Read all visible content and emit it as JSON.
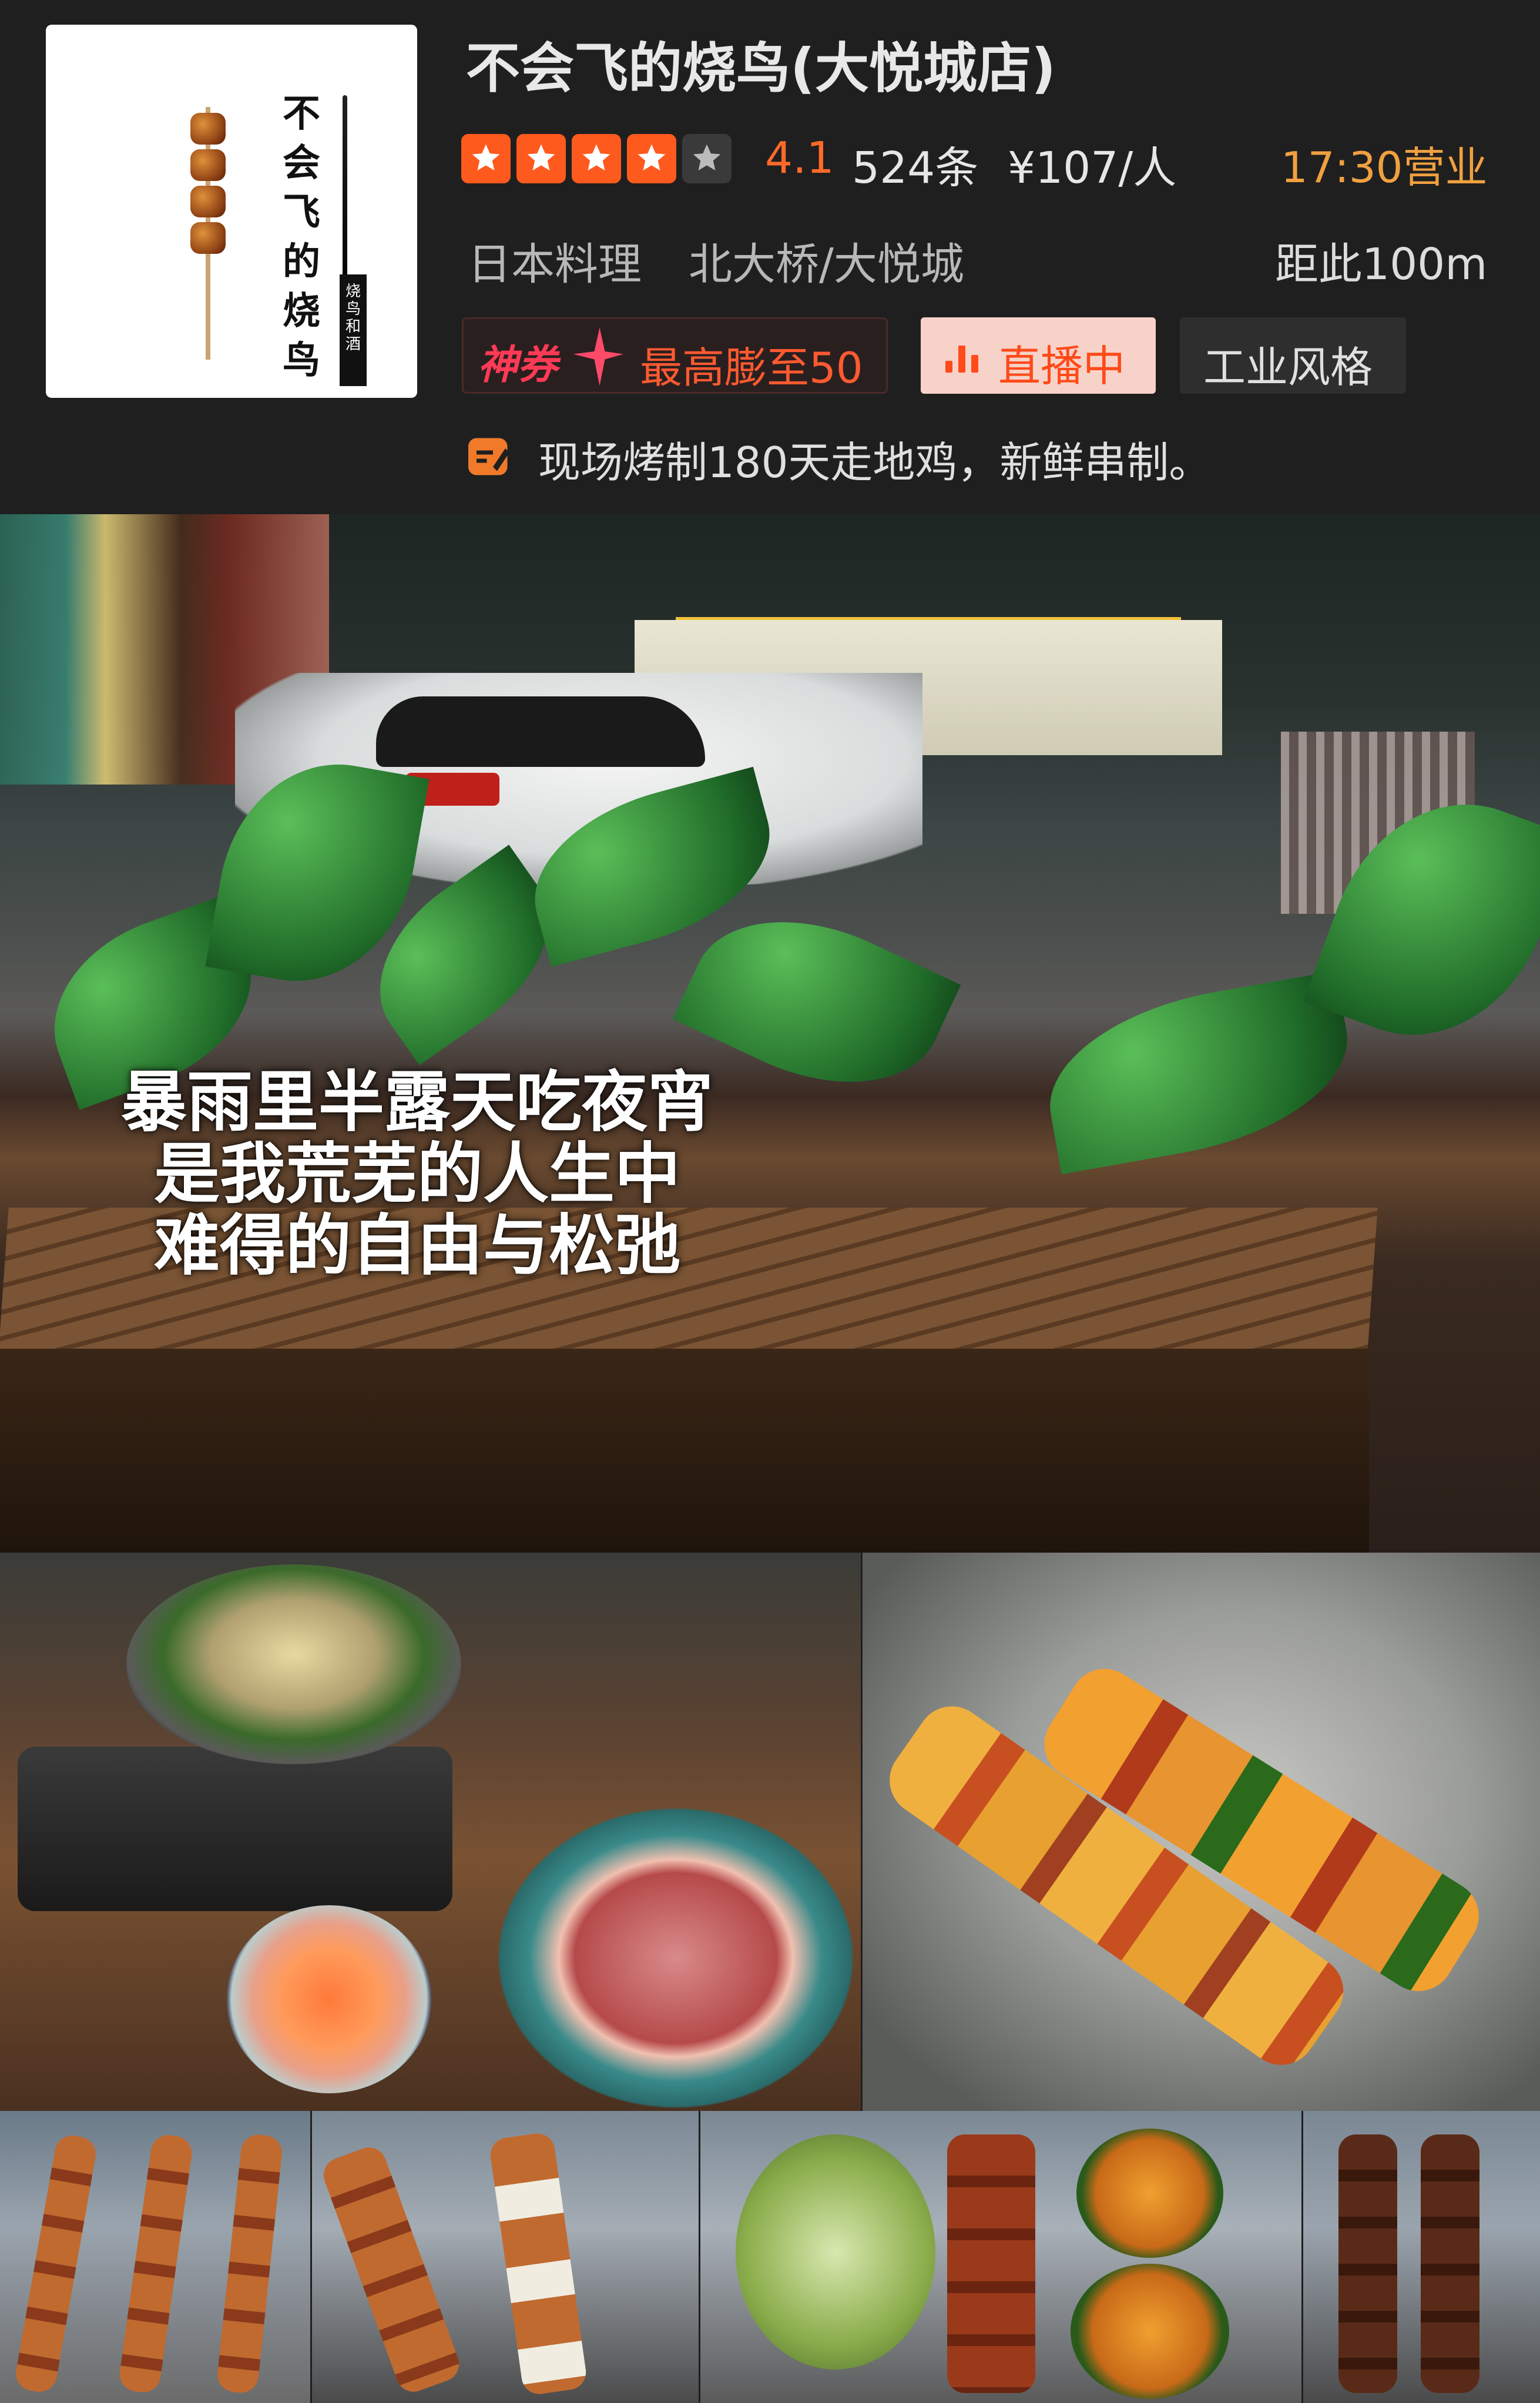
{
  "store": {
    "logo": {
      "brand": "不会飞的烧鸟",
      "tag": "烧鸟和酒"
    },
    "name": "不会飞的烧鸟(大悦城店)",
    "stars": 4.5,
    "rating": "4.1",
    "reviews": "524条",
    "price": "¥107/人",
    "hours": "17:30营业",
    "category": "日本料理",
    "area": "北大桥/大悦城",
    "distance": "距此100m",
    "coupon": {
      "brand": "神券",
      "text": "最高膨至50"
    },
    "live": "直播中",
    "style": "工业风格",
    "note": "现场烤制180天走地鸡，新鲜串制。"
  },
  "hero": {
    "caption": [
      "暴雨里半露天吃夜宵",
      "是我荒芜的人生中",
      "难得的自由与松弛"
    ]
  },
  "colors": {
    "accent": "#ff5a1e",
    "hours": "#f0a040",
    "background": "#1f1f1f"
  }
}
